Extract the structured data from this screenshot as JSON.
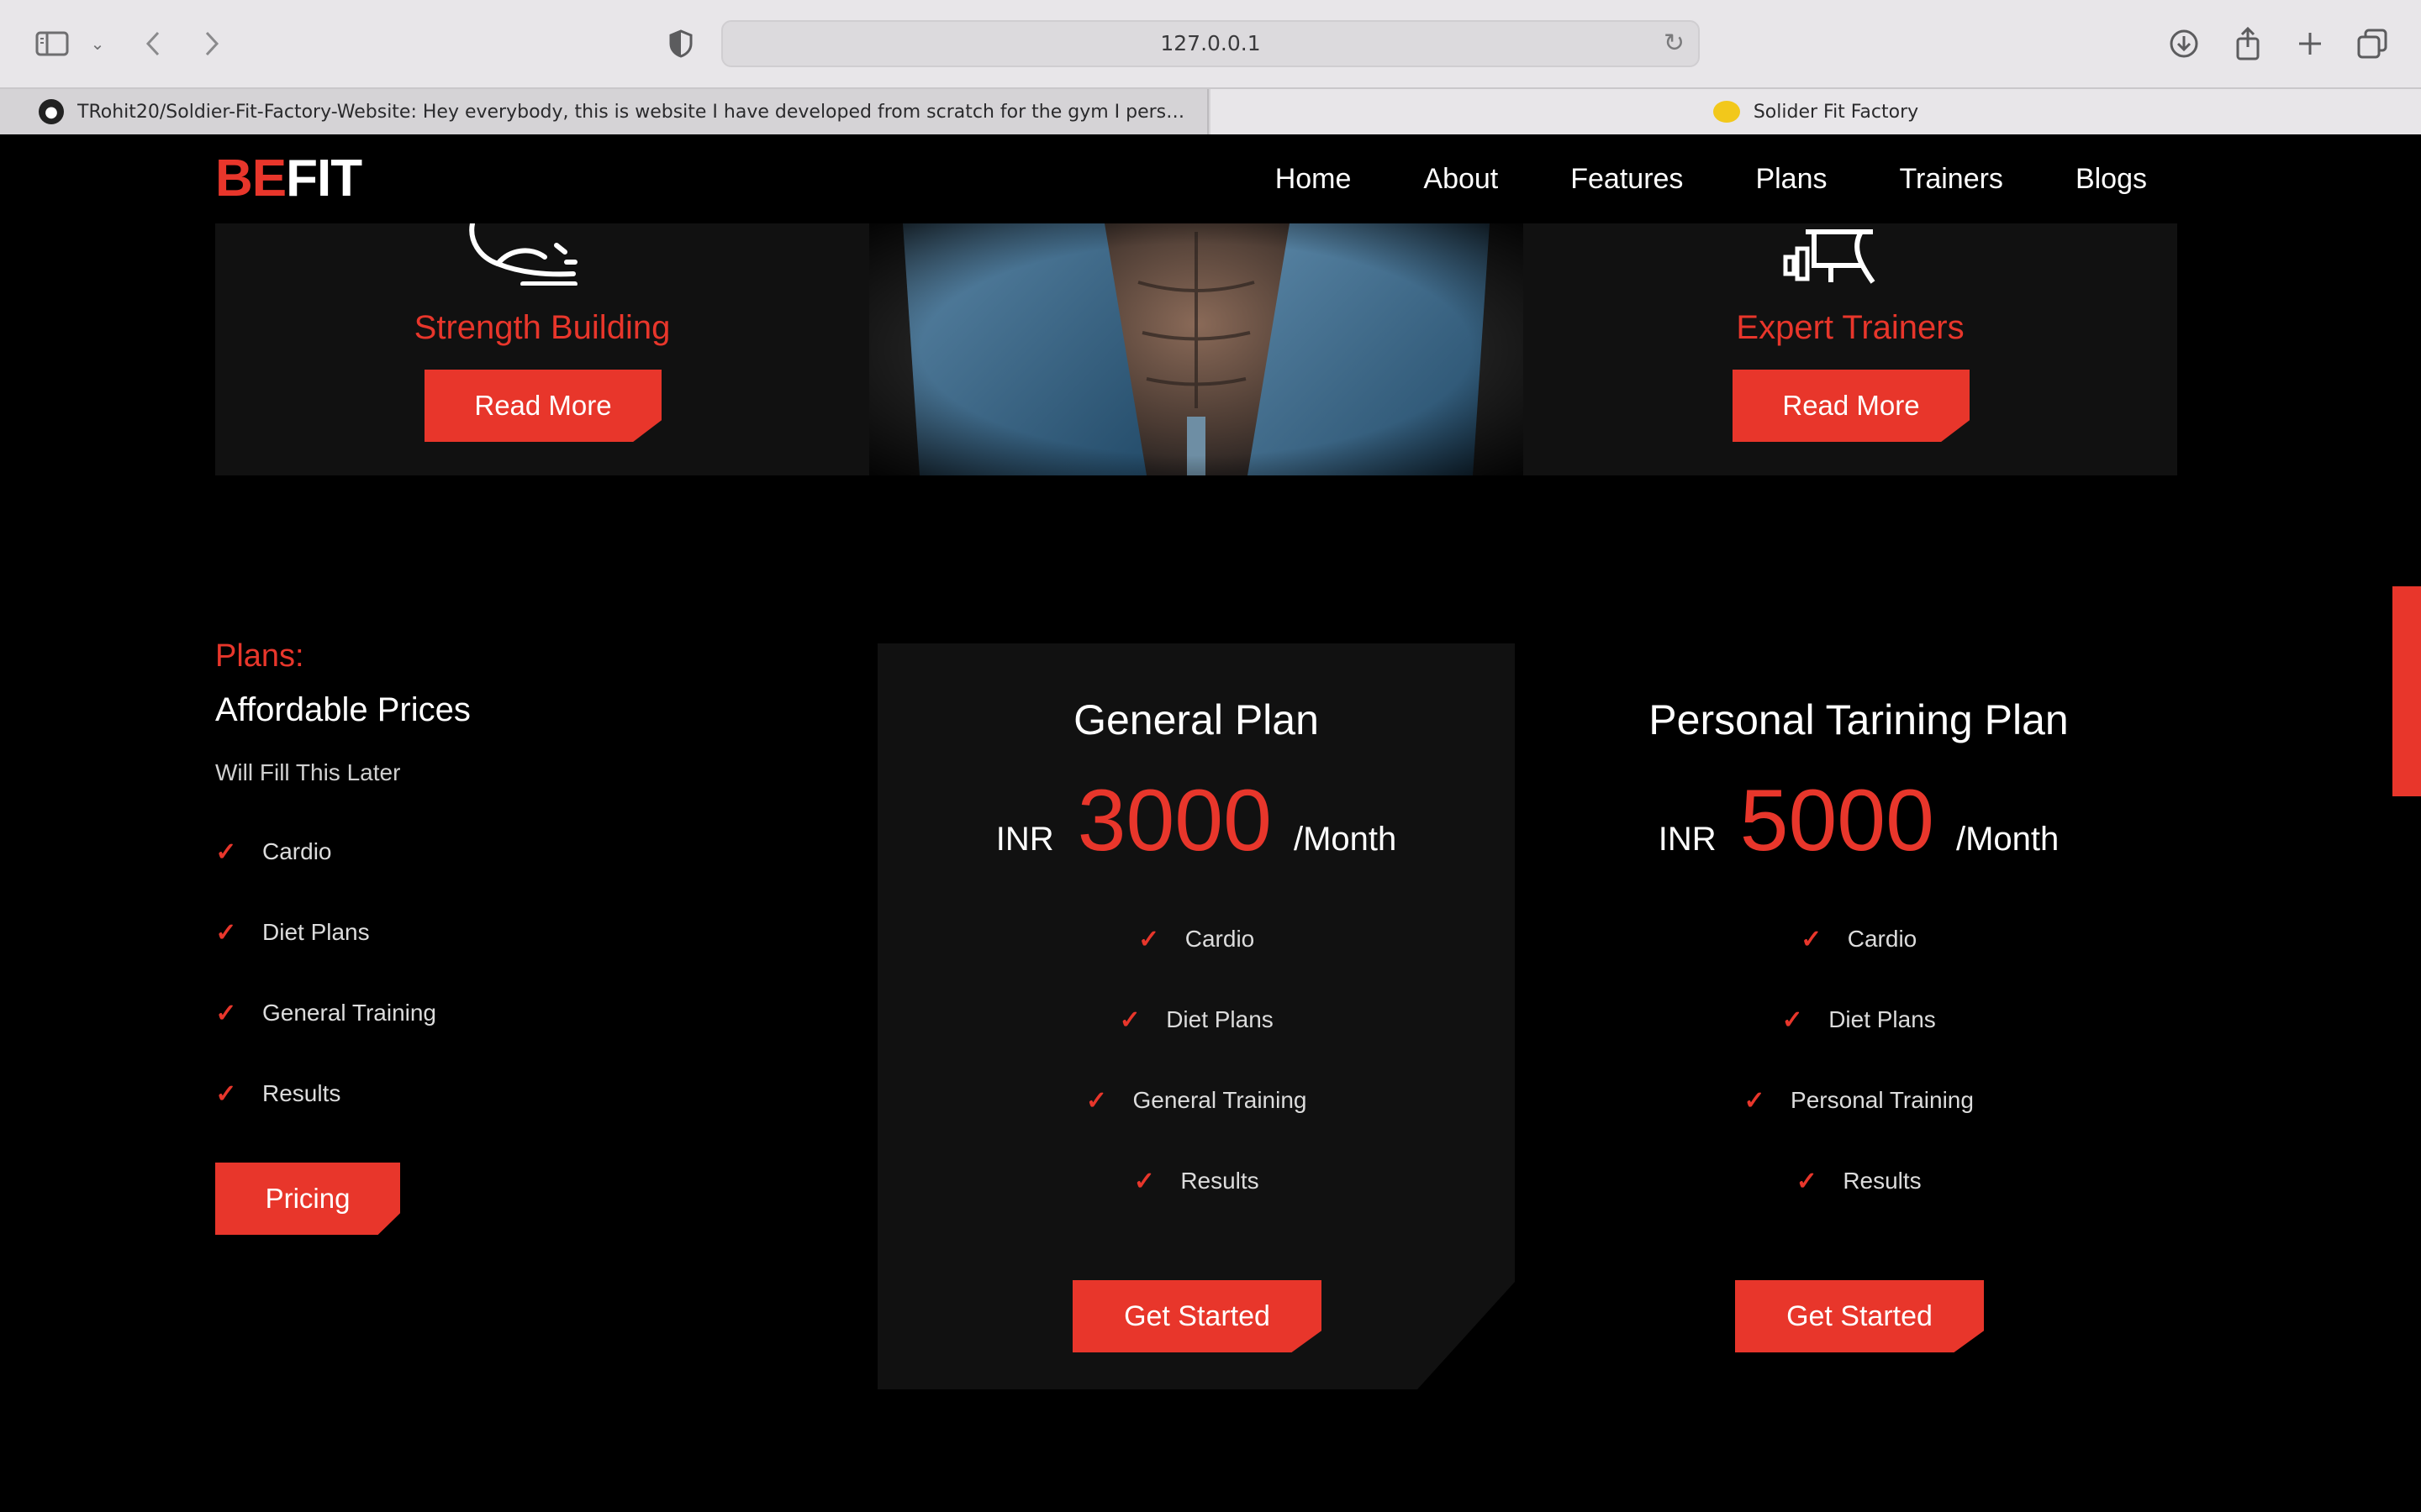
{
  "browser": {
    "url": "127.0.0.1",
    "tabs": [
      {
        "title": "TRohit20/Soldier-Fit-Factory-Website: Hey everybody, this is website I have developed from scratch for the gym I personally..."
      },
      {
        "title": "Solider Fit Factory"
      }
    ],
    "icons": [
      "sidebar-icon",
      "chevron-down-icon",
      "back-icon",
      "forward-icon",
      "shield-icon",
      "reload-icon",
      "download-icon",
      "share-icon",
      "new-tab-icon",
      "tab-overview-icon"
    ]
  },
  "site": {
    "logo": {
      "part1": "BE",
      "part2": "FIT"
    },
    "nav": [
      "Home",
      "About",
      "Features",
      "Plans",
      "Trainers",
      "Blogs"
    ]
  },
  "features": {
    "left": {
      "title": "Strength Building",
      "button": "Read More"
    },
    "right": {
      "title": "Expert Trainers",
      "button": "Read More"
    }
  },
  "plans_intro": {
    "kicker": "Plans:",
    "heading": "Affordable Prices",
    "description": "Will Fill This Later",
    "items": [
      "Cardio",
      "Diet Plans",
      "General Training",
      "Results"
    ],
    "button": "Pricing"
  },
  "plans": [
    {
      "name": "General Plan",
      "currency": "INR",
      "price": "3000",
      "period": "/Month",
      "items": [
        "Cardio",
        "Diet Plans",
        "General Training",
        "Results"
      ],
      "button": "Get Started"
    },
    {
      "name": "Personal Tarining Plan",
      "currency": "INR",
      "price": "5000",
      "period": "/Month",
      "items": [
        "Cardio",
        "Diet Plans",
        "Personal Training",
        "Results"
      ],
      "button": "Get Started"
    }
  ],
  "colors": {
    "accent": "#e8362b",
    "background": "#000000",
    "card": "#111111"
  }
}
